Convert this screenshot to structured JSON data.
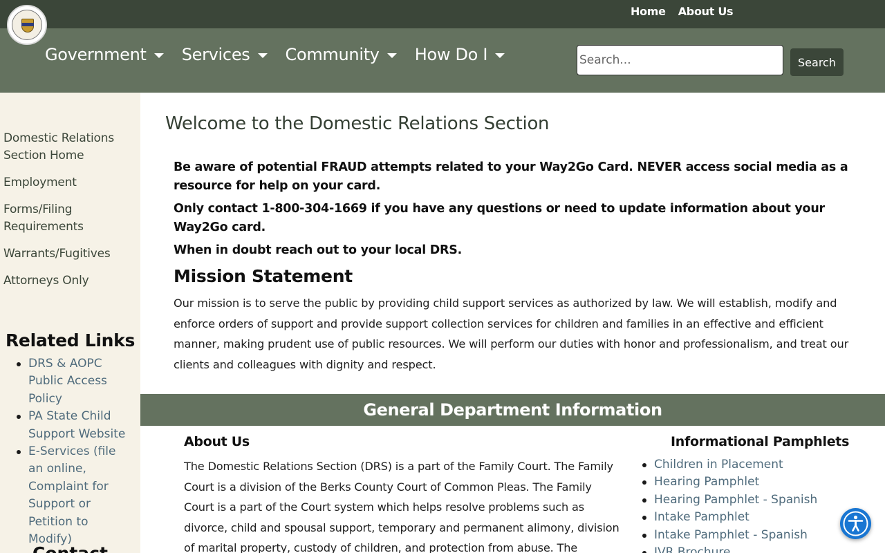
{
  "topbar": {
    "links": [
      "Home",
      "About Us"
    ]
  },
  "nav": {
    "menu": [
      "Government",
      "Services",
      "Community",
      "How Do I"
    ],
    "search_placeholder": "Search...",
    "search_button": "Search"
  },
  "sidebar": {
    "nav": [
      "Domestic Relations Section Home",
      "Employment",
      "Forms/Filing Requirements",
      "Warrants/Fugitives",
      "Attorneys Only"
    ],
    "related_title": "Related Links",
    "related_links": [
      "DRS & AOPC Public Access Policy",
      "PA State Child Support Website",
      "E-Services (file an online, Complaint for Support or Petition to Modify)"
    ],
    "contact_title": "Contact"
  },
  "main": {
    "title": "Welcome to the Domestic Relations Section",
    "notice": [
      "Be aware of potential FRAUD attempts related to your Way2Go Card.      NEVER access social media as a resource for help on your card.",
      "Only contact 1-800-304-1669 if you have any questions or need to update information about your Way2Go card.",
      "When in doubt reach out to your local DRS."
    ],
    "mission_title": "Mission Statement",
    "mission_text": "Our mission is to serve the public by providing child support services as authorized by law. We will establish, modify and enforce orders of support and provide support collection services for children and families in an effective and efficient manner, making prudent use of public resources. We will perform our duties with honor and professionalism, and treat our clients and colleagues with dignity and respect.",
    "section_title": "General Department Information",
    "about_title": "About Us",
    "about_text": "The Domestic Relations Section (DRS) is a part of the Family Court. The Family Court is a division of the Berks County Court of Common Pleas. The Family Court is a part of the Court system which helps resolve problems such as divorce, child and spousal support, temporary and permanent alimony, division of marital property, custody of children, and protection from abuse. The Domestic",
    "pamphlets_title": "Informational Pamphlets",
    "pamphlets": [
      "Children in Placement",
      "Hearing Pamphlet",
      "Hearing Pamphlet - Spanish",
      "Intake Pamphlet",
      "Intake Pamphlet - Spanish",
      "IVR Brochure"
    ]
  },
  "icons": {
    "logo": "county-seal-icon",
    "accessibility": "accessibility-icon"
  }
}
